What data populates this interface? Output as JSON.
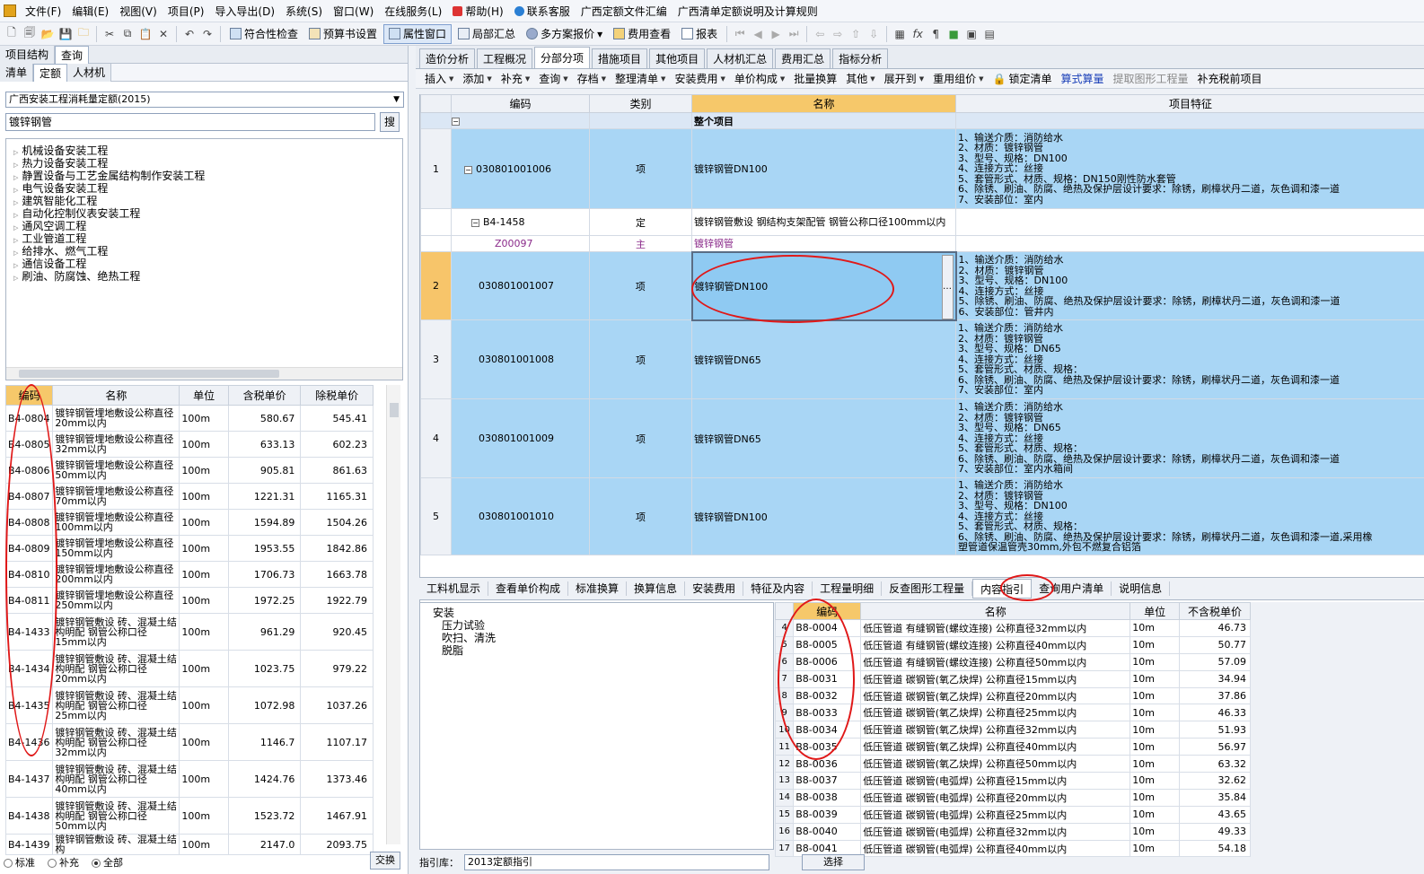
{
  "menu": [
    "文件(F)",
    "编辑(E)",
    "视图(V)",
    "项目(P)",
    "导入导出(D)",
    "系统(S)",
    "窗口(W)",
    "在线服务(L)",
    "帮助(H)",
    "联系客服",
    "广西定额文件汇编",
    "广西清单定额说明及计算规则"
  ],
  "toolbar": {
    "check": "符合性检查",
    "budget_settings": "预算书设置",
    "property_window": "属性窗口",
    "partial_summary": "局部汇总",
    "multi_plan": "多方案报价",
    "fee_check": "费用查看",
    "report": "报表"
  },
  "left_tabs_top": [
    "项目结构",
    "查询"
  ],
  "left_tabs": [
    "清单",
    "定额",
    "人材机"
  ],
  "quota_library": "广西安装工程消耗量定额(2015)",
  "search": {
    "value": "镀锌钢管",
    "button": "搜"
  },
  "tree_nodes": [
    "机械设备安装工程",
    "热力设备安装工程",
    "静置设备与工艺金属结构制作安装工程",
    "电气设备安装工程",
    "建筑智能化工程",
    "自动化控制仪表安装工程",
    "通风空调工程",
    "工业管道工程",
    "给排水、燃气工程",
    "通信设备工程",
    "刷油、防腐蚀、绝热工程"
  ],
  "quota_table": {
    "headers": [
      "编码",
      "名称",
      "单位",
      "含税单价",
      "除税单价"
    ],
    "rows": [
      {
        "code": "B4-0804",
        "name": "镀锌钢管埋地敷设公称直径20mm以内",
        "unit": "100m",
        "tax": "580.67",
        "notax": "545.41"
      },
      {
        "code": "B4-0805",
        "name": "镀锌钢管埋地敷设公称直径32mm以内",
        "unit": "100m",
        "tax": "633.13",
        "notax": "602.23"
      },
      {
        "code": "B4-0806",
        "name": "镀锌钢管埋地敷设公称直径50mm以内",
        "unit": "100m",
        "tax": "905.81",
        "notax": "861.63"
      },
      {
        "code": "B4-0807",
        "name": "镀锌钢管埋地敷设公称直径70mm以内",
        "unit": "100m",
        "tax": "1221.31",
        "notax": "1165.31"
      },
      {
        "code": "B4-0808",
        "name": "镀锌钢管埋地敷设公称直径100mm以内",
        "unit": "100m",
        "tax": "1594.89",
        "notax": "1504.26"
      },
      {
        "code": "B4-0809",
        "name": "镀锌钢管埋地敷设公称直径150mm以内",
        "unit": "100m",
        "tax": "1953.55",
        "notax": "1842.86"
      },
      {
        "code": "B4-0810",
        "name": "镀锌钢管埋地敷设公称直径200mm以内",
        "unit": "100m",
        "tax": "1706.73",
        "notax": "1663.78"
      },
      {
        "code": "B4-0811",
        "name": "镀锌钢管埋地敷设公称直径250mm以内",
        "unit": "100m",
        "tax": "1972.25",
        "notax": "1922.79"
      },
      {
        "code": "B4-1433",
        "name": "镀锌钢管敷设 砖、混凝土结构明配 钢管公称口径15mm以内",
        "unit": "100m",
        "tax": "961.29",
        "notax": "920.45"
      },
      {
        "code": "B4-1434",
        "name": "镀锌钢管敷设 砖、混凝土结构明配 钢管公称口径20mm以内",
        "unit": "100m",
        "tax": "1023.75",
        "notax": "979.22"
      },
      {
        "code": "B4-1435",
        "name": "镀锌钢管敷设 砖、混凝土结构明配 钢管公称口径25mm以内",
        "unit": "100m",
        "tax": "1072.98",
        "notax": "1037.26"
      },
      {
        "code": "B4-1436",
        "name": "镀锌钢管敷设 砖、混凝土结构明配 钢管公称口径32mm以内",
        "unit": "100m",
        "tax": "1146.7",
        "notax": "1107.17"
      },
      {
        "code": "B4-1437",
        "name": "镀锌钢管敷设 砖、混凝土结构明配 钢管公称口径40mm以内",
        "unit": "100m",
        "tax": "1424.76",
        "notax": "1373.46"
      },
      {
        "code": "B4-1438",
        "name": "镀锌钢管敷设 砖、混凝土结构明配 钢管公称口径50mm以内",
        "unit": "100m",
        "tax": "1523.72",
        "notax": "1467.91"
      },
      {
        "code": "B4-1439",
        "name": "镀锌钢管敷设 砖、混凝土结构",
        "unit": "100m",
        "tax": "2147.0",
        "notax": "2093.75"
      }
    ]
  },
  "left_bottom": {
    "opt1": "标准",
    "opt2": "补充",
    "opt3": "全部",
    "swap": "交换"
  },
  "right_tabs": [
    "造价分析",
    "工程概况",
    "分部分项",
    "措施项目",
    "其他项目",
    "人材机汇总",
    "费用汇总",
    "指标分析"
  ],
  "right_tool": [
    "插入",
    "添加",
    "补充",
    "查询",
    "存档",
    "整理清单",
    "安装费用",
    "单价构成",
    "批量换算",
    "其他",
    "展开到",
    "重用组价",
    "锁定清单",
    "算式算量",
    "提取图形工程量",
    "补充税前项目"
  ],
  "grid": {
    "headers": [
      "编码",
      "类别",
      "名称",
      "项目特征"
    ],
    "whole": "整个项目",
    "rows": [
      {
        "no": "1",
        "code": "030801001006",
        "type": "项",
        "name": "镀锌钢管DN100",
        "feat": [
          "1、输送介质：消防给水",
          "2、材质：镀锌钢管",
          "3、型号、规格：DN100",
          "4、连接方式：丝接",
          "5、套管形式、材质、规格：DN150刚性防水套管",
          "6、除锈、刷油、防腐、绝热及保护层设计要求：除锈，刷樟状丹二道，灰色调和漆一道",
          "7、安装部位：室内"
        ]
      },
      {
        "code": "B4-1458",
        "type": "定",
        "name": "镀锌钢管敷设 钢结构支架配管 钢管公称口径100mm以内"
      },
      {
        "code": "Z00097",
        "type": "主",
        "name": "镀锌钢管"
      },
      {
        "no": "2",
        "code": "030801001007",
        "type": "项",
        "name": "镀锌钢管DN100",
        "feat": [
          "1、输送介质：消防给水",
          "2、材质：镀锌钢管",
          "3、型号、规格：DN100",
          "4、连接方式：丝接",
          "5、除锈、刷油、防腐、绝热及保护层设计要求：除锈，刷樟状丹二道，灰色调和漆一道",
          "6、安装部位：管井内"
        ]
      },
      {
        "no": "3",
        "code": "030801001008",
        "type": "项",
        "name": "镀锌钢管DN65",
        "feat": [
          "1、输送介质：消防给水",
          "2、材质：镀锌钢管",
          "3、型号、规格：DN65",
          "4、连接方式：丝接",
          "5、套管形式、材质、规格：",
          "6、除锈、刷油、防腐、绝热及保护层设计要求：除锈，刷樟状丹二道，灰色调和漆一道",
          "7、安装部位：室内"
        ]
      },
      {
        "no": "4",
        "code": "030801001009",
        "type": "项",
        "name": "镀锌钢管DN65",
        "feat": [
          "1、输送介质：消防给水",
          "2、材质：镀锌钢管",
          "3、型号、规格：DN65",
          "4、连接方式：丝接",
          "5、套管形式、材质、规格：",
          "6、除锈、刷油、防腐、绝热及保护层设计要求：除锈，刷樟状丹二道，灰色调和漆一道",
          "7、安装部位：室内水箱间"
        ]
      },
      {
        "no": "5",
        "code": "030801001010",
        "type": "项",
        "name": "镀锌钢管DN100",
        "feat": [
          "1、输送介质：消防给水",
          "2、材质：镀锌钢管",
          "3、型号、规格：DN100",
          "4、连接方式：丝接",
          "5、套管形式、材质、规格：",
          "6、除锈、刷油、防腐、绝热及保护层设计要求：除锈，刷樟状丹二道，灰色调和漆一道,采用橡",
          "塑管道保温管壳30mm,外包不燃复合铝箔"
        ]
      }
    ]
  },
  "bottom_tabs": [
    "工料机显示",
    "查看单价构成",
    "标准换算",
    "换算信息",
    "安装费用",
    "特征及内容",
    "工程量明细",
    "反查图形工程量",
    "内容指引",
    "查询用户清单",
    "说明信息"
  ],
  "bottom_tree": [
    "安装",
    "压力试验",
    "吹扫、清洗",
    "脱脂"
  ],
  "guide_table": {
    "headers": [
      "编码",
      "名称",
      "单位",
      "不含税单价"
    ],
    "rows": [
      {
        "no": "4",
        "code": "B8-0004",
        "name": "低压管道 有缝钢管(螺纹连接) 公称直径32mm以内",
        "unit": "10m",
        "price": "46.73"
      },
      {
        "no": "5",
        "code": "B8-0005",
        "name": "低压管道 有缝钢管(螺纹连接) 公称直径40mm以内",
        "unit": "10m",
        "price": "50.77"
      },
      {
        "no": "6",
        "code": "B8-0006",
        "name": "低压管道 有缝钢管(螺纹连接) 公称直径50mm以内",
        "unit": "10m",
        "price": "57.09"
      },
      {
        "no": "7",
        "code": "B8-0031",
        "name": "低压管道 碳钢管(氧乙炔焊) 公称直径15mm以内",
        "unit": "10m",
        "price": "34.94"
      },
      {
        "no": "8",
        "code": "B8-0032",
        "name": "低压管道 碳钢管(氧乙炔焊) 公称直径20mm以内",
        "unit": "10m",
        "price": "37.86"
      },
      {
        "no": "9",
        "code": "B8-0033",
        "name": "低压管道 碳钢管(氧乙炔焊) 公称直径25mm以内",
        "unit": "10m",
        "price": "46.33"
      },
      {
        "no": "10",
        "code": "B8-0034",
        "name": "低压管道 碳钢管(氧乙炔焊) 公称直径32mm以内",
        "unit": "10m",
        "price": "51.93"
      },
      {
        "no": "11",
        "code": "B8-0035",
        "name": "低压管道 碳钢管(氧乙炔焊) 公称直径40mm以内",
        "unit": "10m",
        "price": "56.97"
      },
      {
        "no": "12",
        "code": "B8-0036",
        "name": "低压管道 碳钢管(氧乙炔焊) 公称直径50mm以内",
        "unit": "10m",
        "price": "63.32"
      },
      {
        "no": "13",
        "code": "B8-0037",
        "name": "低压管道 碳钢管(电弧焊) 公称直径15mm以内",
        "unit": "10m",
        "price": "32.62"
      },
      {
        "no": "14",
        "code": "B8-0038",
        "name": "低压管道 碳钢管(电弧焊) 公称直径20mm以内",
        "unit": "10m",
        "price": "35.84"
      },
      {
        "no": "15",
        "code": "B8-0039",
        "name": "低压管道 碳钢管(电弧焊) 公称直径25mm以内",
        "unit": "10m",
        "price": "43.65"
      },
      {
        "no": "16",
        "code": "B8-0040",
        "name": "低压管道 碳钢管(电弧焊) 公称直径32mm以内",
        "unit": "10m",
        "price": "49.33"
      },
      {
        "no": "17",
        "code": "B8-0041",
        "name": "低压管道 碳钢管(电弧焊) 公称直径40mm以内",
        "unit": "10m",
        "price": "54.18"
      }
    ]
  },
  "bottom_footer": {
    "label": "指引库：",
    "value": "2013定额指引",
    "choose": "选择"
  }
}
